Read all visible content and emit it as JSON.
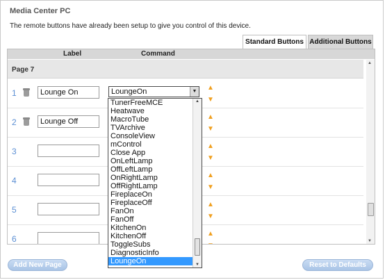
{
  "window": {
    "title": "Media Center PC",
    "description": "The remote buttons have already been setup to give you control of this device."
  },
  "tabs": [
    {
      "label": "Standard Buttons",
      "active": true
    },
    {
      "label": "Additional Buttons",
      "active": false
    }
  ],
  "table": {
    "headers": {
      "label": "Label",
      "command": "Command"
    },
    "page_title": "Page 7",
    "rows": [
      {
        "num": "1",
        "label": "Lounge On",
        "command": "LoungeOn",
        "has_delete": true
      },
      {
        "num": "2",
        "label": "Lounge Off",
        "command": "",
        "has_delete": true
      },
      {
        "num": "3",
        "label": "",
        "command": "",
        "has_delete": false
      },
      {
        "num": "4",
        "label": "",
        "command": "",
        "has_delete": false
      },
      {
        "num": "5",
        "label": "",
        "command": "",
        "has_delete": false
      },
      {
        "num": "6",
        "label": "",
        "command": "",
        "has_delete": false
      }
    ]
  },
  "dropdown": {
    "options": [
      "TunerFreeMCE",
      "Heatwave",
      "MacroTube",
      "TVArchive",
      "ConsoleView",
      "mControl",
      "Close App",
      "OnLeftLamp",
      "OffLeftLamp",
      "OnRightLamp",
      "OffRightLamp",
      "FireplaceOn",
      "FireplaceOff",
      "FanOn",
      "FanOff",
      "KitchenOn",
      "KitchenOff",
      "ToggleSubs",
      "DiagnosticInfo",
      "LoungeOn"
    ],
    "selected": "LoungeOn"
  },
  "buttons": {
    "add_page": "Add New Page",
    "reset": "Reset to Defaults"
  },
  "icons": {
    "delete": "trash-icon",
    "move_up": "arrow-up-icon",
    "move_down": "arrow-down-icon"
  },
  "colors": {
    "row_number": "#5a8ed3",
    "arrows": "#f0a020",
    "selected_option": "#3399ff",
    "button_bg": "#b9d0ee"
  }
}
